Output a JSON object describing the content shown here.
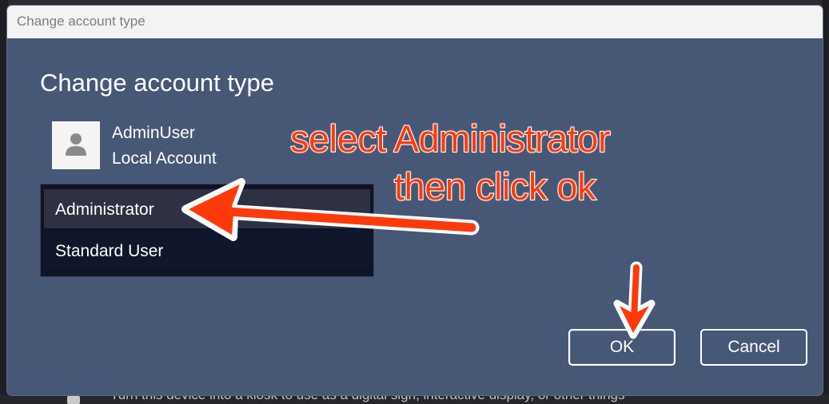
{
  "background": {
    "description_text": "Turn this device into a kiosk to use as a digital sign, interactive display, or other things"
  },
  "dialog": {
    "window_title": "Change account type",
    "heading": "Change account type",
    "account": {
      "name": "AdminUser",
      "type": "Local Account",
      "avatar_icon": "person-icon"
    },
    "dropdown": {
      "selected_value": "Administrator",
      "options": [
        "Administrator",
        "Standard User"
      ]
    },
    "buttons": {
      "ok_label": "OK",
      "cancel_label": "Cancel"
    }
  },
  "annotation": {
    "line1": "select Administrator",
    "line2": "then click ok",
    "color": "#ff3a0a",
    "arrows": [
      "arrow-to-administrator",
      "arrow-to-ok"
    ]
  },
  "colors": {
    "dialog_bg": "#475876",
    "titlebar_bg": "#f3f3f3",
    "dropdown_bg": "#0f1326",
    "dropdown_selected_bg": "#2e3141"
  }
}
